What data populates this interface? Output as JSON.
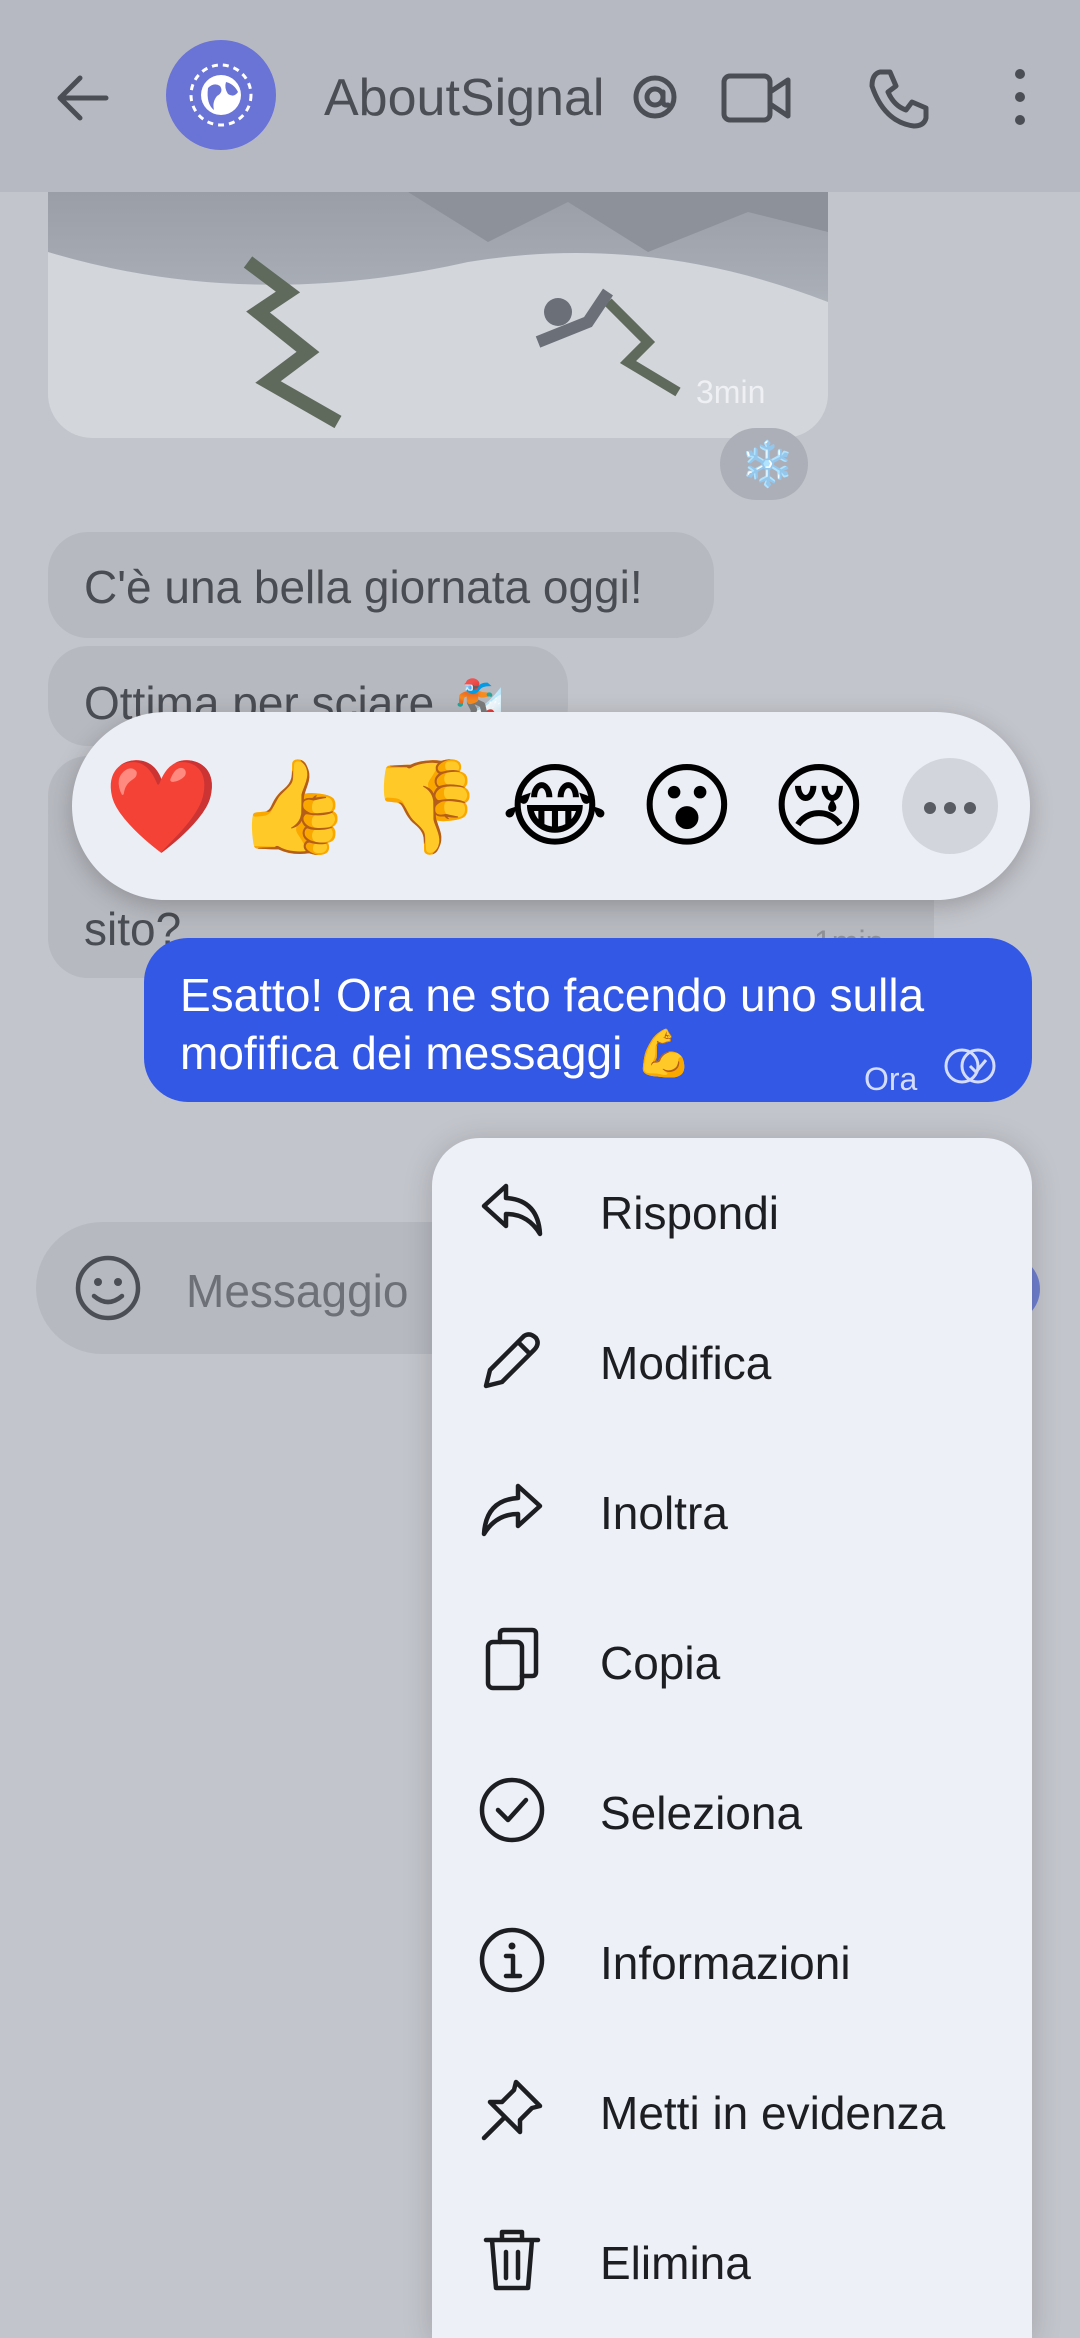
{
  "header": {
    "contact_name": "AboutSignal",
    "icons": [
      "back-arrow-icon",
      "globe-avatar-icon",
      "at-sign-icon",
      "video-call-icon",
      "phone-icon",
      "more-vert-icon"
    ]
  },
  "messages": {
    "image_time": "3min",
    "image_reaction": "❄️",
    "incoming": [
      {
        "text": "C'è una bella giornata oggi!"
      },
      {
        "text": "Ottima per sciare 🏂"
      },
      {
        "text": "sito?",
        "time": "1min"
      }
    ],
    "outgoing": {
      "line1": "Esatto! Ora ne sto facendo uno sulla",
      "line2": "mofifica dei messaggi 💪",
      "time": "Ora"
    }
  },
  "reactions": [
    "❤️",
    "👍",
    "👎",
    "😂",
    "😮",
    "😢"
  ],
  "composer": {
    "placeholder": "Messaggio"
  },
  "menu": {
    "items": [
      {
        "label": "Rispondi",
        "icon": "reply-icon"
      },
      {
        "label": "Modifica",
        "icon": "pencil-icon"
      },
      {
        "label": "Inoltra",
        "icon": "forward-icon"
      },
      {
        "label": "Copia",
        "icon": "copy-icon"
      },
      {
        "label": "Seleziona",
        "icon": "check-circle-icon"
      },
      {
        "label": "Informazioni",
        "icon": "info-icon"
      },
      {
        "label": "Metti in evidenza",
        "icon": "pin-icon"
      },
      {
        "label": "Elimina",
        "icon": "trash-icon"
      }
    ]
  },
  "colors": {
    "outgoing_bubble": "#3458e6",
    "avatar": "#6a73d6",
    "menu_bg": "#eef0f8",
    "scrim_bg": "#c3c5cc"
  }
}
